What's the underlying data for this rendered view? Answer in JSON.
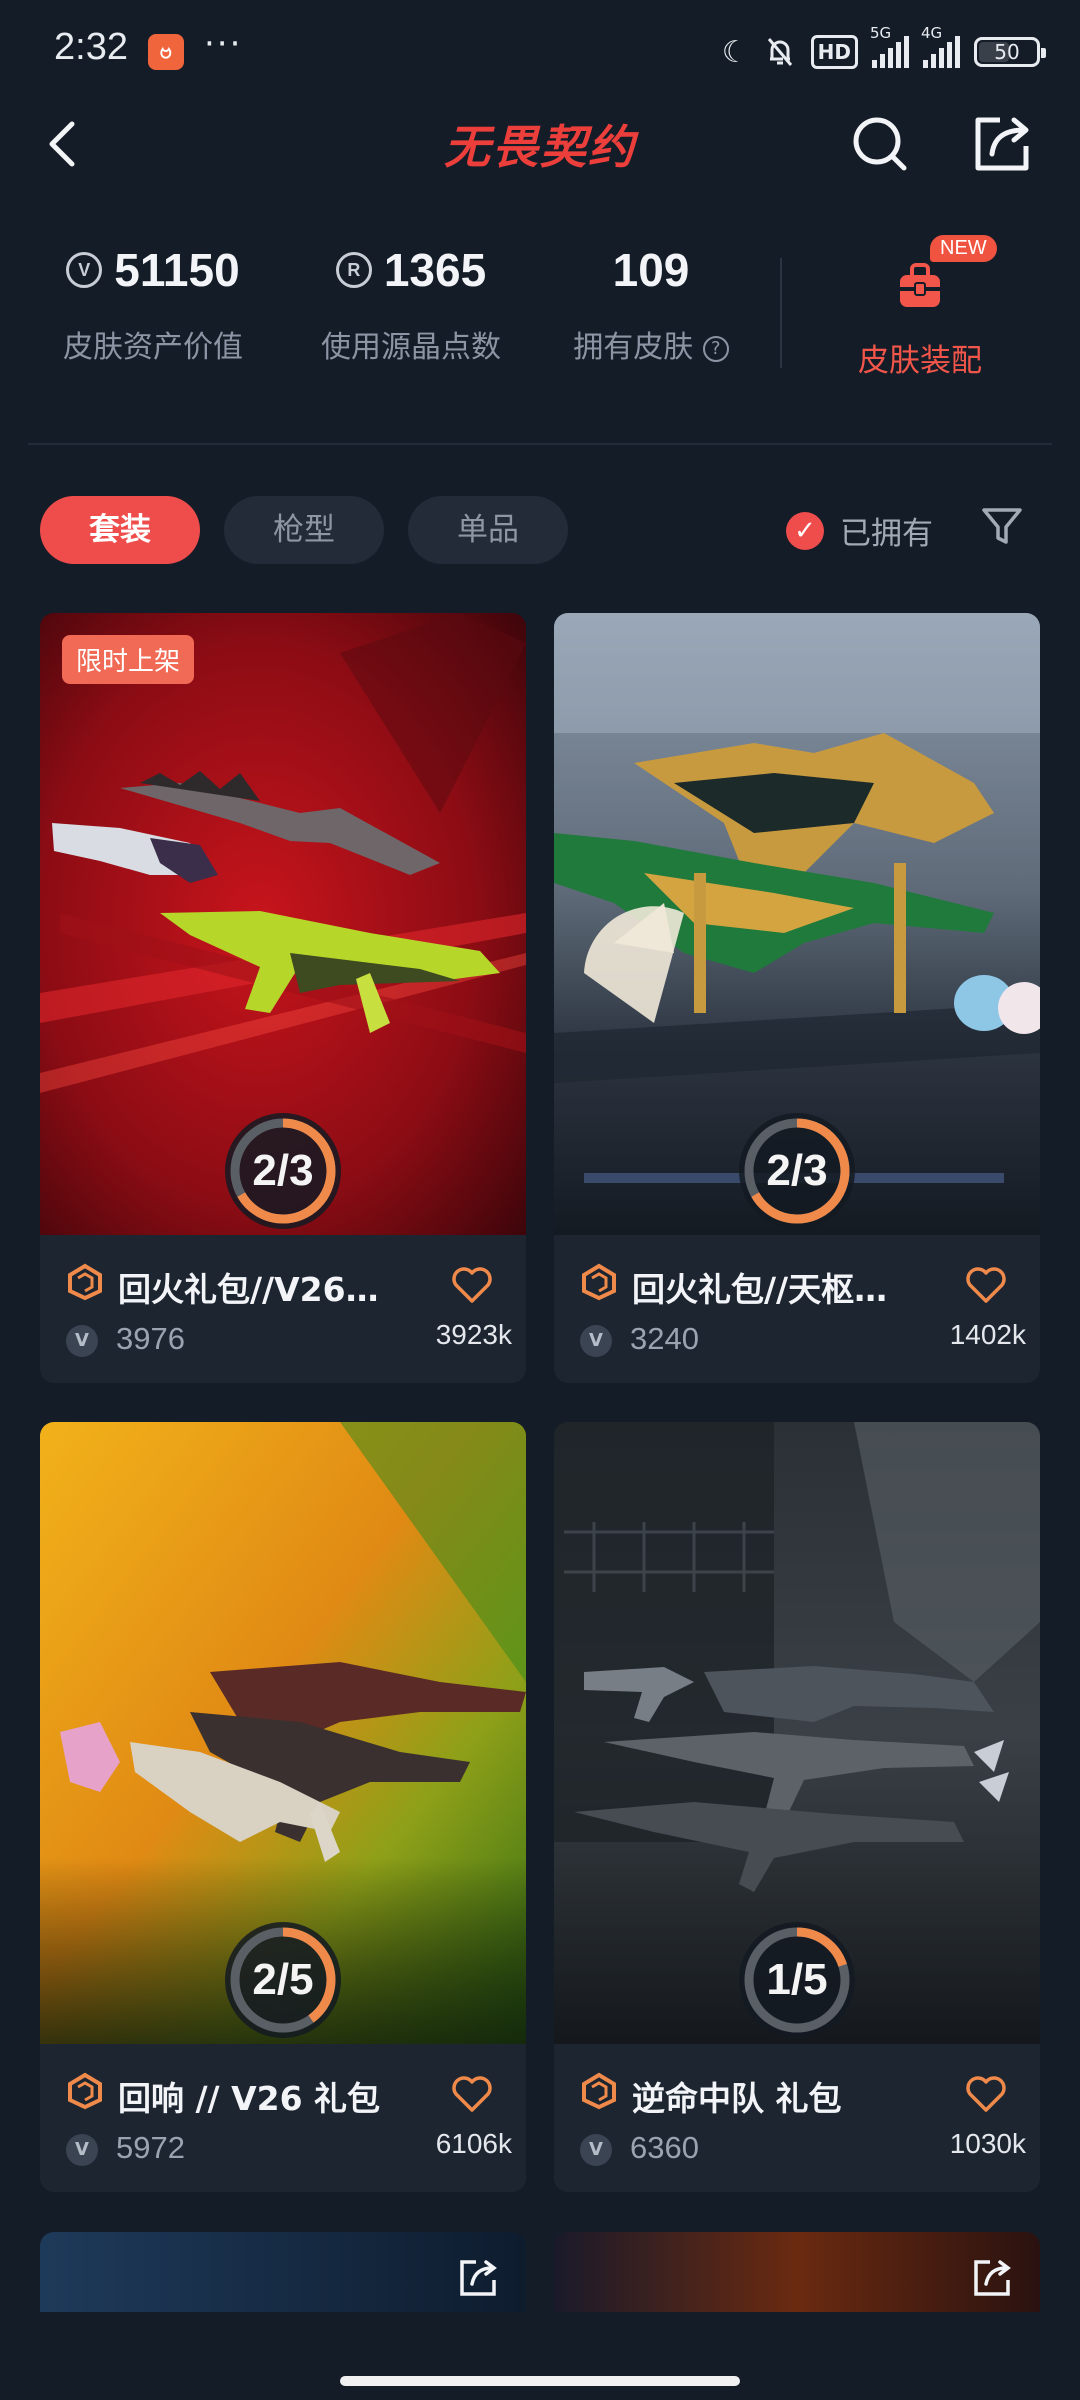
{
  "status_bar": {
    "time": "2:32",
    "app_icon": "ဗ",
    "dots": "···",
    "hd": "HD",
    "net1": "5G",
    "net2": "4G",
    "battery": "50",
    "icons": [
      "moon-icon",
      "bell-off-icon"
    ]
  },
  "header": {
    "title": "无畏契约",
    "back_icon": "chevron-left-icon",
    "search_icon": "search-icon",
    "share_icon": "share-icon"
  },
  "stats": [
    {
      "value": "51150",
      "label": "皮肤资产价值",
      "icon": "vp-icon"
    },
    {
      "value": "1365",
      "label": "使用源晶点数",
      "icon": "radianite-icon"
    },
    {
      "value": "109",
      "label": "拥有皮肤",
      "icon": "help-icon"
    }
  ],
  "help_mark": "?",
  "config": {
    "label": "皮肤装配",
    "badge": "NEW"
  },
  "tabs": [
    {
      "label": "套装",
      "active": true
    },
    {
      "label": "枪型",
      "active": false
    },
    {
      "label": "单品",
      "active": false
    }
  ],
  "owned_filter": {
    "label": "已拥有",
    "checked": true,
    "check_glyph": "✓"
  },
  "cards": [
    {
      "title": "回火礼包//V26…",
      "price": "3976",
      "likes": "3923k",
      "progress": "2/3",
      "progress_fraction": 0.667,
      "limited_label": "限时上架",
      "vp": "V"
    },
    {
      "title": "回火礼包//天枢…",
      "price": "3240",
      "likes": "1402k",
      "progress": "2/3",
      "progress_fraction": 0.667,
      "vp": "V"
    },
    {
      "title": "回响 // V26 礼包",
      "price": "5972",
      "likes": "6106k",
      "progress": "2/5",
      "progress_fraction": 0.4,
      "vp": "V"
    },
    {
      "title": "逆命中队 礼包",
      "price": "6360",
      "likes": "1030k",
      "progress": "1/5",
      "progress_fraction": 0.2,
      "vp": "V"
    }
  ],
  "colors": {
    "accent": "#ef4c4c",
    "background": "#141c27",
    "card": "#1d2531",
    "progress": "#f08a4a"
  }
}
